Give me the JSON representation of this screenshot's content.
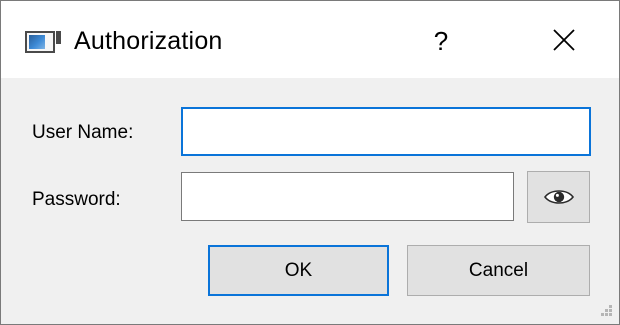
{
  "window": {
    "title": "Authorization",
    "help_glyph": "?",
    "icons": {
      "app": "app-window-icon",
      "close": "close-icon",
      "password_toggle": "eye-icon",
      "resize": "resize-grip-icon"
    }
  },
  "form": {
    "username_label": "User Name:",
    "username_value": "",
    "password_label": "Password:",
    "password_value": ""
  },
  "buttons": {
    "ok_label": "OK",
    "cancel_label": "Cancel"
  },
  "colors": {
    "focus_accent": "#0a74d9",
    "button_face": "#e1e1e1",
    "dialog_background": "#f0f0f0"
  }
}
